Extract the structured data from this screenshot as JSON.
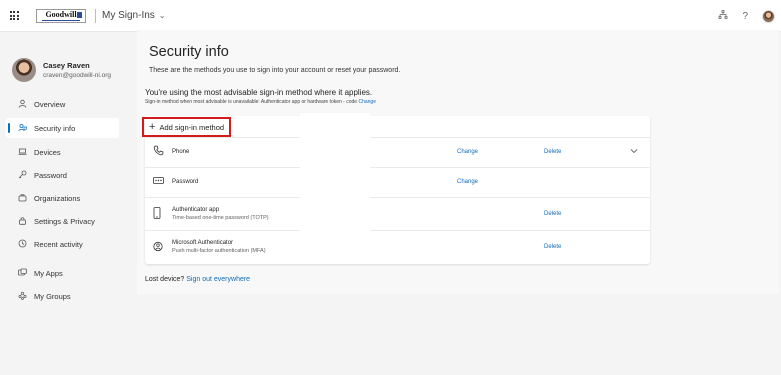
{
  "header": {
    "logo_text": "Goodwill",
    "app_title": "My Sign-Ins",
    "icons": [
      "app-launcher-icon",
      "org-chart-icon",
      "help-icon",
      "avatar"
    ]
  },
  "profile": {
    "name": "Casey Raven",
    "email": "craven@goodwill-ni.org"
  },
  "nav": {
    "items": [
      {
        "label": "Overview",
        "icon": "person-icon"
      },
      {
        "label": "Security info",
        "icon": "security-info-icon",
        "active": true
      },
      {
        "label": "Devices",
        "icon": "laptop-icon"
      },
      {
        "label": "Password",
        "icon": "key-icon"
      },
      {
        "label": "Organizations",
        "icon": "briefcase-icon"
      },
      {
        "label": "Settings & Privacy",
        "icon": "lock-icon"
      },
      {
        "label": "Recent activity",
        "icon": "history-icon"
      },
      {
        "label": "My Apps",
        "icon": "apps-icon"
      },
      {
        "label": "My Groups",
        "icon": "groups-icon"
      }
    ]
  },
  "main": {
    "title": "Security info",
    "subtitle": "These are the methods you use to sign into your account or reset your password.",
    "advisable": "You're using the most advisable sign-in method where it applies.",
    "advisable_note": "Sign-in method when most advisable is unavailable: Authenticator app or hardware token - code",
    "advisable_change": "Change",
    "add_method": "Add sign-in method",
    "methods": [
      {
        "name": "Phone",
        "description": "",
        "change": "Change",
        "delete": "Delete",
        "icon": "phone-icon"
      },
      {
        "name": "Password",
        "description": "",
        "change": "Change",
        "delete": "",
        "icon": "password-icon"
      },
      {
        "name": "Authenticator app",
        "description": "Time-based one-time password (TOTP)",
        "change": "",
        "delete": "Delete",
        "icon": "mobile-icon"
      },
      {
        "name": "Microsoft Authenticator",
        "description": "Push multi-factor authentication (MFA)",
        "change": "",
        "delete": "Delete",
        "icon": "authenticator-icon"
      }
    ],
    "lost_device": "Lost device?",
    "sign_out_everywhere": "Sign out everywhere"
  },
  "colors": {
    "accent": "#0f6cbd",
    "highlight_border": "#d31b1b",
    "background": "#f4f4f4"
  }
}
